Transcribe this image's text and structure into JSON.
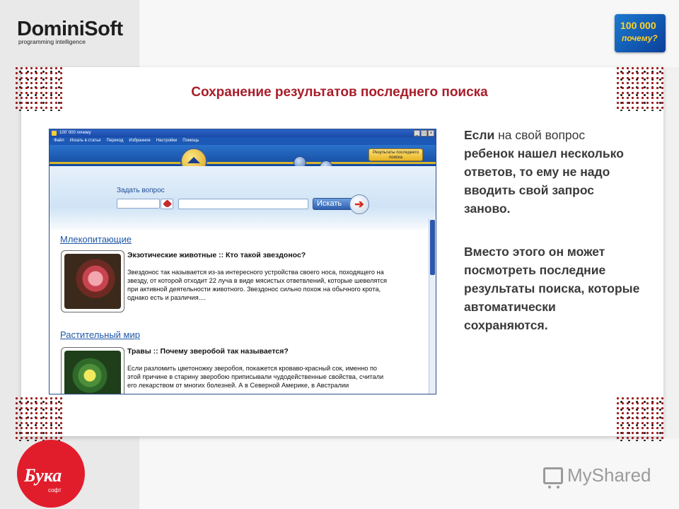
{
  "header": {
    "brand": "DominiSoft",
    "tagline": "programming intelligence",
    "badge_line1": "100 000",
    "badge_line2": "почему?"
  },
  "slide": {
    "title": "Сохранение результатов последнего поиска"
  },
  "app": {
    "window_title": "100' 000 почему",
    "window_buttons": [
      "_",
      "□",
      "×"
    ],
    "menu": [
      "Файл",
      "Искать в статье",
      "Переход",
      "Избранное",
      "Настройки",
      "Помощь"
    ],
    "results_button": "Результаты последнего поиска",
    "ask_label": "Задать вопрос",
    "search_button": "Искать",
    "categories": [
      {
        "label": "Млекопитающие",
        "item_title": "Экзотические животные :: Кто такой звездонос?",
        "item_body": "Звездонос так называется из-за интересного устройства своего носа, походящего на звезду, от которой отходит 22 луча в виде мясистых ответвлений, которые шевелятся при активной деятельности животного. Звездонос сильно похож на обычного крота, однако есть и различия....",
        "thumb": "star-nosed-mole-photo"
      },
      {
        "label": "Растительный мир",
        "item_title": "Травы :: Почему зверобой так называется?",
        "item_body": "Если разломить цветоножку зверобоя, покажется кроваво-красный сок, именно по этой причине в старину зверобою приписывали чудодейственные свойства, считали его лекарством от многих болезней. А в Северной Америке, в Австралии",
        "thumb": "st-johns-wort-photo"
      }
    ]
  },
  "side_text": {
    "p1_lead": "Если",
    "p1_rest_normal": " на свой вопрос",
    "p1_more": "ребенок нашел несколько ответов, то ему не надо вводить свой запрос заново.",
    "p2": "Вместо этого он может посмотреть последние результаты поиска, которые автоматически сохраняются."
  },
  "footer": {
    "buka_name": "Бука",
    "buka_sub": "софт",
    "myshared": "MyShared"
  },
  "colors": {
    "title_red": "#a81d2a",
    "app_blue": "#1c58b5",
    "buka_red": "#e11d2c"
  }
}
